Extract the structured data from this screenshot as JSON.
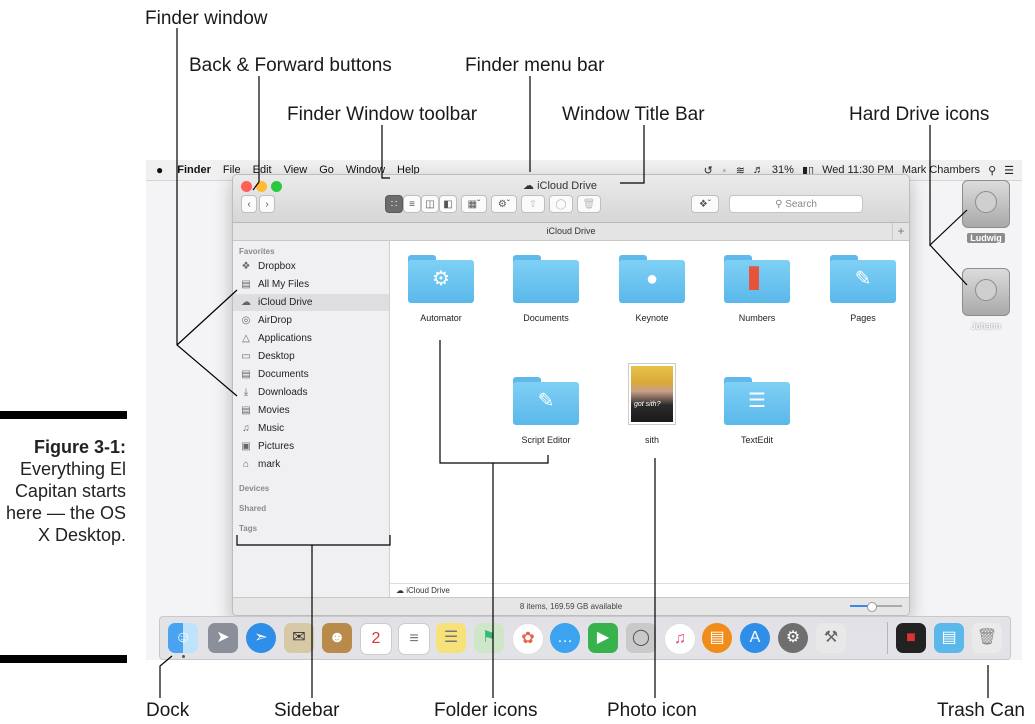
{
  "callouts": {
    "finder_window": "Finder window",
    "back_forward": "Back & Forward buttons",
    "finder_menu_bar": "Finder menu bar",
    "toolbar": "Finder Window toolbar",
    "title_bar": "Window Title Bar",
    "hard_drive_icons": "Hard Drive icons",
    "dock": "Dock",
    "sidebar": "Sidebar",
    "folder_icons": "Folder icons",
    "photo_icon": "Photo icon",
    "trash_can": "Trash Can"
  },
  "caption": {
    "label": "Figure 3-1:",
    "text": "Everything El Capitan starts here — the OS X Desktop."
  },
  "menubar": {
    "app": "Finder",
    "items": [
      "File",
      "Edit",
      "View",
      "Go",
      "Window",
      "Help"
    ],
    "battery": "31%",
    "clock": "Wed 11:30 PM",
    "user": "Mark Chambers"
  },
  "window": {
    "title": "iCloud Drive",
    "path_title": "iCloud Drive",
    "search_placeholder": "Search",
    "bottom_path": "iCloud Drive",
    "status": "8 items, 169.59 GB available"
  },
  "sidebar": {
    "favorites_header": "Favorites",
    "items": [
      {
        "label": "Dropbox",
        "icon": "dropbox-icon"
      },
      {
        "label": "All My Files",
        "icon": "all-files-icon"
      },
      {
        "label": "iCloud Drive",
        "icon": "cloud-icon"
      },
      {
        "label": "AirDrop",
        "icon": "airdrop-icon"
      },
      {
        "label": "Applications",
        "icon": "applications-icon"
      },
      {
        "label": "Desktop",
        "icon": "desktop-icon"
      },
      {
        "label": "Documents",
        "icon": "documents-icon"
      },
      {
        "label": "Downloads",
        "icon": "downloads-icon"
      },
      {
        "label": "Movies",
        "icon": "movies-icon"
      },
      {
        "label": "Music",
        "icon": "music-icon"
      },
      {
        "label": "Pictures",
        "icon": "pictures-icon"
      },
      {
        "label": "mark",
        "icon": "home-icon"
      }
    ],
    "devices_header": "Devices",
    "shared_header": "Shared",
    "tags_header": "Tags"
  },
  "folders": [
    {
      "label": "Automator",
      "icon": "automator-icon"
    },
    {
      "label": "Documents",
      "icon": "folder-icon"
    },
    {
      "label": "Keynote",
      "icon": "keynote-icon"
    },
    {
      "label": "Numbers",
      "icon": "numbers-icon"
    },
    {
      "label": "Pages",
      "icon": "pages-icon"
    },
    {
      "label": "Script Editor",
      "icon": "script-editor-icon"
    },
    {
      "label": "sith",
      "icon": "photo-icon",
      "photo_text": "got sith?"
    },
    {
      "label": "TextEdit",
      "icon": "textedit-icon"
    }
  ],
  "drives": [
    {
      "name": "Ludwig"
    },
    {
      "name": "Johann"
    }
  ],
  "colors": {
    "folder_blue": "#5ab8ea",
    "close": "#ff5f57",
    "minimize": "#febc2e",
    "zoom": "#28c840",
    "selection": "#dedee2"
  }
}
